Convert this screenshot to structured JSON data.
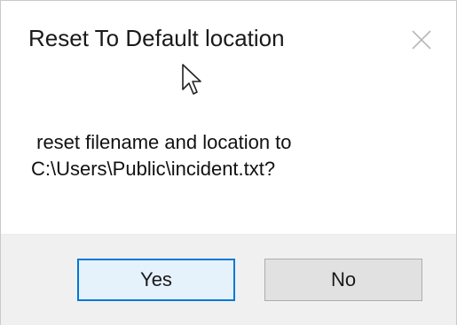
{
  "dialog": {
    "title": "Reset To Default location",
    "close_icon": "close-icon",
    "message_line1": " reset filename and location to",
    "message_line2": "C:\\Users\\Public\\incident.txt?",
    "buttons": {
      "yes": "Yes",
      "no": "No"
    },
    "accent_color": "#0078d7",
    "footer_color": "#f0f0f0"
  }
}
